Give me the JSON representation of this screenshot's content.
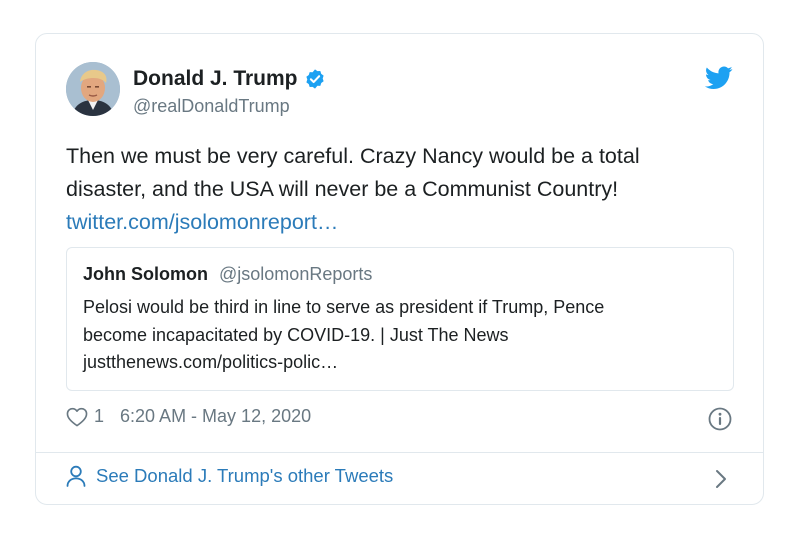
{
  "author": {
    "name": "Donald J. Trump",
    "handle": "@realDonaldTrump",
    "verified": true
  },
  "tweet": {
    "line1": "Then we must be very careful. Crazy Nancy would be a total",
    "line2": "disaster, and the USA will never be a Communist Country!",
    "link": "twitter.com/jsolomonreport…"
  },
  "quoted_tweet": {
    "name": "John Solomon",
    "handle": "@jsolomonReports",
    "line1": "Pelosi would be third in line to serve as president if Trump, Pence",
    "line2": "become incapacitated by COVID-19.  | Just The News",
    "line3": "justthenews.com/politics-polic…"
  },
  "meta": {
    "like_count": "1",
    "timestamp": "6:20 AM - May 12, 2020"
  },
  "footer": {
    "see_more_label": "See Donald J. Trump's other Tweets"
  },
  "icons": {
    "verified": "verified-badge-icon",
    "twitter": "twitter-bird-icon",
    "like": "heart-icon",
    "info": "info-icon",
    "profile": "person-icon",
    "next": "chevron-right-icon"
  },
  "colors": {
    "link": "#2b7bb9",
    "verified": "#1da1f2",
    "secondary_text": "#697882",
    "border": "#e1e8ed"
  }
}
